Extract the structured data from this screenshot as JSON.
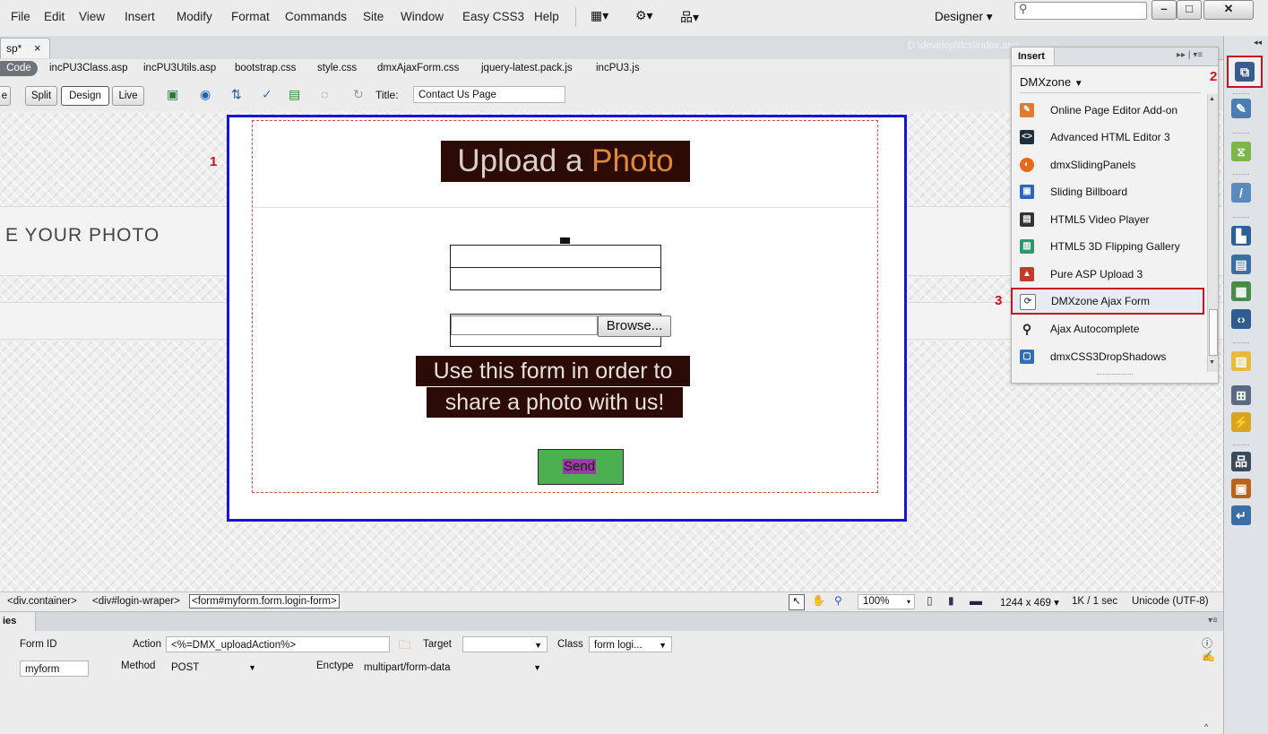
{
  "menubar": {
    "items": [
      "File",
      "Edit",
      "View",
      "Insert",
      "Modify",
      "Format",
      "Commands",
      "Site",
      "Window",
      "Easy CSS3",
      "Help"
    ],
    "workspace": "Designer",
    "workspace_arrow": "▾"
  },
  "doc_tab": {
    "name": "sp*",
    "close": "×",
    "path": "D:\\develop\\tfcs\\index.asp"
  },
  "related_files": {
    "code_label": "Code",
    "files": [
      "incPU3Class.asp",
      "incPU3Utils.asp",
      "bootstrap.css",
      "style.css",
      "dmxAjaxForm.css",
      "jquery-latest.pack.js",
      "incPU3.js"
    ]
  },
  "document_toolbar": {
    "views": [
      "e",
      "Split",
      "Design",
      "Live"
    ],
    "title_label": "Title:",
    "title_value": "Contact Us Page"
  },
  "design_view": {
    "heading_part1": "Upload a ",
    "heading_part2": "Photo",
    "side_text": "E YOUR PHOTO",
    "browse_label": "Browse...",
    "description_line1": "Use this form in order to",
    "description_line2": "share a photo with us!",
    "send_label": "Send"
  },
  "annotations": {
    "one": "1",
    "two": "2",
    "three": "3"
  },
  "insert_panel": {
    "tab_label": "Insert",
    "category": "DMXzone",
    "category_arrow": "▼",
    "items": [
      {
        "label": "Online Page Editor Add-on",
        "icon": "page-editor-icon",
        "color": "#e07a2d"
      },
      {
        "label": "Advanced HTML Editor 3",
        "icon": "html-editor-icon",
        "color": "#1e2f3c"
      },
      {
        "label": "dmxSlidingPanels",
        "icon": "sliding-panels-icon",
        "color": "#e66a17"
      },
      {
        "label": "Sliding Billboard",
        "icon": "sliding-billboard-icon",
        "color": "#2a64c8"
      },
      {
        "label": "HTML5 Video Player",
        "icon": "clapperboard-icon",
        "color": "#333333"
      },
      {
        "label": "HTML5 3D Flipping Gallery",
        "icon": "flipping-gallery-icon",
        "color": "#2a9a6d"
      },
      {
        "label": "Pure ASP Upload 3",
        "icon": "upload-icon",
        "color": "#c23b2b"
      },
      {
        "label": "DMXzone Ajax Form",
        "icon": "ajax-form-icon",
        "color": "#555555"
      },
      {
        "label": "Ajax Autocomplete",
        "icon": "magnifier-icon",
        "color": "#222222"
      },
      {
        "label": "dmxCSS3DropShadows",
        "icon": "drop-shadows-icon",
        "color": "#2f6fb5"
      }
    ]
  },
  "status_bar": {
    "tag_selector": [
      "<div.container>",
      "<div#login-wraper>",
      "<form#myform.form.login-form>"
    ],
    "zoom": "100%",
    "dimensions": "1244 x 469",
    "download": "1K / 1 sec",
    "encoding": "Unicode (UTF-8)"
  },
  "properties": {
    "header": "ies",
    "form_id_label": "Form ID",
    "form_id_value": "myform",
    "action_label": "Action",
    "action_value": "<%=DMX_uploadAction%>",
    "target_label": "Target",
    "target_value": "",
    "class_label": "Class",
    "class_value": "form logi...",
    "method_label": "Method",
    "method_value": "POST",
    "enctype_label": "Enctype",
    "enctype_value": "multipart/form-data"
  },
  "colors": {
    "form_border": "#1515d8",
    "heading_bg": "#2c0a05",
    "photo_text": "#e08a34",
    "send_bg": "#4caf50",
    "annotation": "#c8141b"
  }
}
